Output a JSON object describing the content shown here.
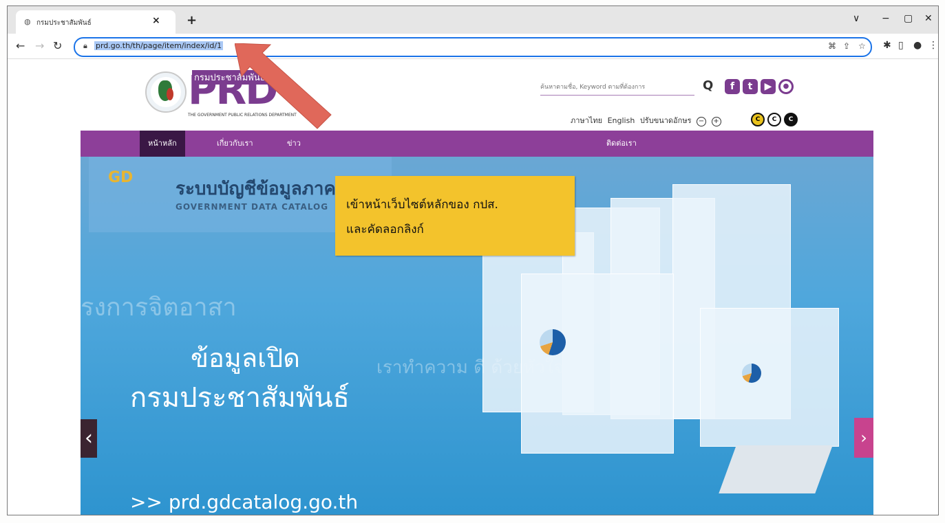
{
  "browser": {
    "tab_title": "กรมประชาสัมพันธ์",
    "tab_close": "×",
    "new_tab": "+",
    "url": "prd.go.th/th/page/item/index/id/1",
    "window_controls": [
      "∨",
      "−",
      "▢",
      "✕"
    ]
  },
  "site": {
    "logo_text": "PRD",
    "logo_small": "กรมประชาสัมพันธ์",
    "logo_caption": "THE GOVERNMENT PUBLIC RELATIONS DEPARTMENT",
    "search_placeholder": "ค้นหาตามชื่อ, Keyword ตามที่ต้องการ",
    "language_thai": "ภาษาไทย",
    "language_english": "English",
    "font_size_label": "ปรับขนาดอักษร",
    "nav": [
      "หน้าหลัก",
      "เกี่ยวกับเรา",
      "ข่าว",
      "ติดต่อเรา"
    ],
    "active_nav": "หน้าหลัก"
  },
  "hero": {
    "catalog_logo": "GD",
    "catalog_title": "ระบบบัญชีข้อมูลภาครัฐ",
    "catalog_subtitle": "GOVERNMENT DATA CATALOG",
    "title_line1": "ข้อมูลเปิด",
    "title_line2": "กรมประชาสัมพันธ์",
    "link": ">> prd.gdcatalog.go.th",
    "ghost_text1": "รงการจิตอาสา",
    "ghost_text2": "เราทำความ ดี ด้วยหัวใจ",
    "prev_arrow": "‹",
    "next_arrow": "›"
  },
  "annotation": {
    "line1": "เข้าหน้าเว็บไซต์หลักของ กปส.",
    "line2": "และคัดลอกลิงก์",
    "arrow_color": "#e0685a",
    "box_color": "#f3c32c"
  },
  "colors": {
    "brand_purple": "#8d3f99",
    "active_nav": "#3a1745",
    "hero_blue": "#4fa7dc"
  }
}
